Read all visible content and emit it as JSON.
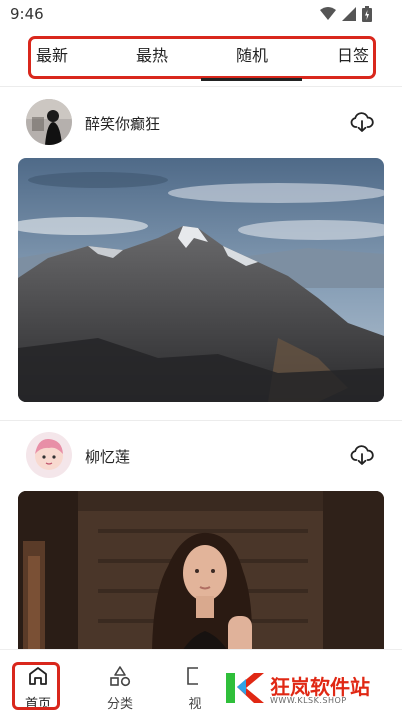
{
  "status_bar": {
    "time": "9:46"
  },
  "tabs": [
    {
      "label": "最新"
    },
    {
      "label": "最热"
    },
    {
      "label": "随机"
    },
    {
      "label": "日签"
    }
  ],
  "posts": [
    {
      "username": "醉笑你癫狂",
      "image": "mountain-peak-photo"
    },
    {
      "username": "柳忆莲",
      "image": "woman-portrait-photo"
    }
  ],
  "bottom_nav": [
    {
      "label": "首页",
      "icon": "home-icon"
    },
    {
      "label": "分类",
      "icon": "category-icon"
    },
    {
      "label": "视",
      "icon": "video-icon"
    }
  ],
  "watermark": {
    "text": "狂岚软件站",
    "url": "WWW.KLSK.SHOP"
  },
  "colors": {
    "highlight": "#d9271c",
    "watermark": "#e02814"
  }
}
